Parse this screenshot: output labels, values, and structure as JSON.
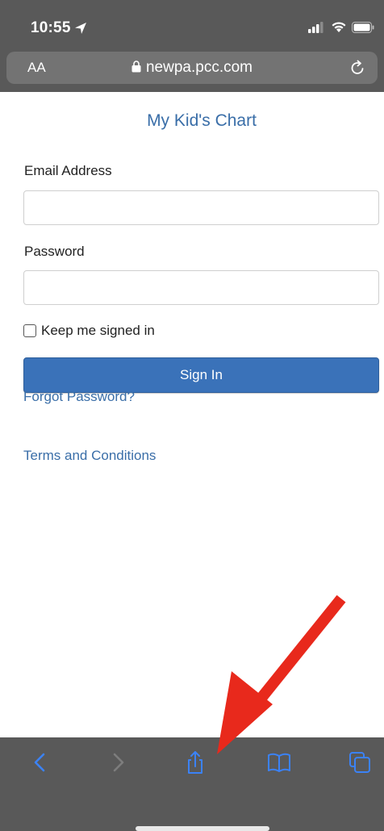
{
  "status_bar": {
    "time": "10:55",
    "icons": [
      "location-arrow-icon",
      "cellular-signal-icon",
      "wifi-icon",
      "battery-icon"
    ]
  },
  "address_bar": {
    "text_size_button": "AA",
    "url": "newpa.pcc.com",
    "icons": [
      "lock-icon",
      "reload-icon"
    ]
  },
  "page": {
    "title": "My Kid's Chart",
    "email": {
      "label": "Email Address",
      "value": "",
      "placeholder": ""
    },
    "password": {
      "label": "Password",
      "value": "",
      "placeholder": ""
    },
    "keep_signed_in": {
      "label": "Keep me signed in",
      "checked": false
    },
    "signin_button": "Sign In",
    "forgot_password_link": "Forgot Password?",
    "terms_link": "Terms and Conditions"
  },
  "toolbar": {
    "items": [
      "back-icon",
      "forward-icon",
      "share-icon",
      "bookmarks-icon",
      "tabs-icon"
    ]
  },
  "colors": {
    "chrome_bg": "#595959",
    "address_bar_bg": "#737373",
    "link_blue": "#3a6ea8",
    "button_blue": "#3a72b9",
    "toolbar_active": "#3b82f6",
    "annotation_red": "#e8291c"
  }
}
